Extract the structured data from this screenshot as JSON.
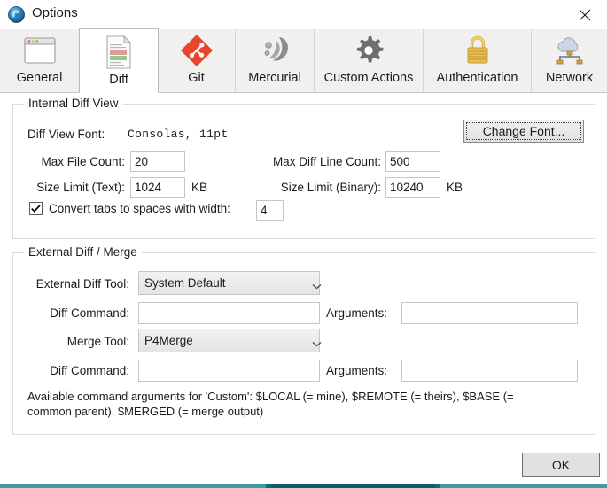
{
  "window": {
    "title": "Options",
    "app_icon": "sourcetree-icon",
    "close_label": "✕"
  },
  "tabs": [
    {
      "id": "general",
      "label": "General",
      "icon": "window-icon",
      "selected": false
    },
    {
      "id": "diff",
      "label": "Diff",
      "icon": "diff-document-icon",
      "selected": true
    },
    {
      "id": "git",
      "label": "Git",
      "icon": "git-icon",
      "selected": false
    },
    {
      "id": "mercurial",
      "label": "Mercurial",
      "icon": "mercurial-icon",
      "selected": false
    },
    {
      "id": "custom-actions",
      "label": "Custom Actions",
      "icon": "gear-icon",
      "selected": false
    },
    {
      "id": "authentication",
      "label": "Authentication",
      "icon": "padlock-icon",
      "selected": false
    },
    {
      "id": "network",
      "label": "Network",
      "icon": "cloud-network-icon",
      "selected": false
    }
  ],
  "internal_diff": {
    "group_title": "Internal Diff View",
    "font_label": "Diff View Font:",
    "font_value": "Consolas, 11pt",
    "change_font_button": "Change Font...",
    "max_file_count_label": "Max File Count:",
    "max_file_count_value": "20",
    "max_diff_line_count_label": "Max Diff Line Count:",
    "max_diff_line_count_value": "500",
    "size_limit_text_label": "Size Limit (Text):",
    "size_limit_text_value": "1024",
    "size_limit_text_unit": "KB",
    "size_limit_binary_label": "Size Limit (Binary):",
    "size_limit_binary_value": "10240",
    "size_limit_binary_unit": "KB",
    "convert_tabs_label": "Convert tabs to spaces with width:",
    "convert_tabs_checked": true,
    "tab_width_value": "4"
  },
  "external_diff": {
    "group_title": "External Diff / Merge",
    "diff_tool_label": "External Diff Tool:",
    "diff_tool_value": "System Default",
    "diff_tool_options": [
      "System Default"
    ],
    "diff_command_label_1": "Diff Command:",
    "diff_command_value_1": "",
    "diff_command_placeholder_1": "",
    "arguments_label_1": "Arguments:",
    "arguments_value_1": "",
    "arguments_placeholder_1": "",
    "merge_tool_label": "Merge Tool:",
    "merge_tool_value": "P4Merge",
    "merge_tool_options": [
      "P4Merge"
    ],
    "diff_command_label_2": "Diff Command:",
    "diff_command_value_2": "",
    "diff_command_placeholder_2": "",
    "arguments_label_2": "Arguments:",
    "arguments_value_2": "",
    "arguments_placeholder_2": "",
    "help_line_1": "Available command arguments for 'Custom': $LOCAL (= mine), $REMOTE (= theirs), $BASE (=",
    "help_line_2": "common parent), $MERGED (= merge output)"
  },
  "footer": {
    "ok_label": "OK"
  },
  "colors": {
    "git_red": "#e8452c",
    "lock_gold": "#e0b23c",
    "diff_add_green": "#8cc78c",
    "diff_del_red": "#d98a8a",
    "tab_selected_bg": "#ffffff",
    "tabstrip_bg": "#f0f0f0",
    "accent_teal": "#0e6f78"
  }
}
